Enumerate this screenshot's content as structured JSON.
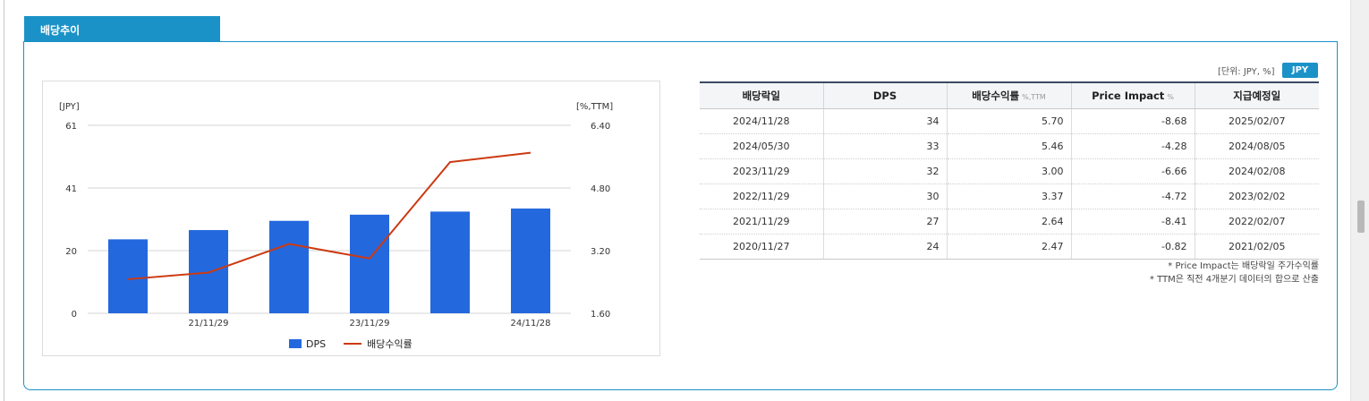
{
  "section_title": "배당추이",
  "unit_note": "[단위: JPY, %]",
  "currency_badge": "JPY",
  "chart_data": {
    "type": "bar",
    "categories": [
      "20/11/27",
      "21/11/29",
      "22/11/29",
      "23/11/29",
      "24/05/30",
      "24/11/28"
    ],
    "x_tick_labels": [
      "",
      "21/11/29",
      "",
      "23/11/29",
      "",
      "24/11/28"
    ],
    "series": [
      {
        "name": "DPS",
        "type": "bar",
        "axis": "left",
        "color": "#2468de",
        "values": [
          24,
          27,
          30,
          32,
          33,
          34
        ]
      },
      {
        "name": "배당수익률",
        "type": "line",
        "axis": "right",
        "color": "#cc3a12",
        "values": [
          2.47,
          2.64,
          3.37,
          3.0,
          5.46,
          5.7
        ]
      }
    ],
    "y_left": {
      "label": "[JPY]",
      "ticks": [
        "61",
        "41",
        "20",
        "0"
      ],
      "ylim": [
        0,
        61
      ]
    },
    "y_right": {
      "label": "[%,TTM]",
      "ticks": [
        "6.40",
        "4.80",
        "3.20",
        "1.60"
      ],
      "ylim": [
        1.6,
        6.4
      ]
    },
    "grid": true,
    "legend": "bottom"
  },
  "table": {
    "headers": [
      {
        "label": "배당락일",
        "sub": ""
      },
      {
        "label": "DPS",
        "sub": ""
      },
      {
        "label": "배당수익률",
        "sub": "%,TTM"
      },
      {
        "label": "Price Impact",
        "sub": "%"
      },
      {
        "label": "지급예정일",
        "sub": ""
      }
    ],
    "rows": [
      [
        "2024/11/28",
        "34",
        "5.70",
        "-8.68",
        "2025/02/07"
      ],
      [
        "2024/05/30",
        "33",
        "5.46",
        "-4.28",
        "2024/08/05"
      ],
      [
        "2023/11/29",
        "32",
        "3.00",
        "-6.66",
        "2024/02/08"
      ],
      [
        "2022/11/29",
        "30",
        "3.37",
        "-4.72",
        "2023/02/02"
      ],
      [
        "2021/11/29",
        "27",
        "2.64",
        "-8.41",
        "2022/02/07"
      ],
      [
        "2020/11/27",
        "24",
        "2.47",
        "-0.82",
        "2021/02/05"
      ]
    ]
  },
  "notes": [
    "* Price Impact는 배당락일 주가수익률",
    "* TTM은 직전 4개분기 데이터의 합으로 산출"
  ]
}
